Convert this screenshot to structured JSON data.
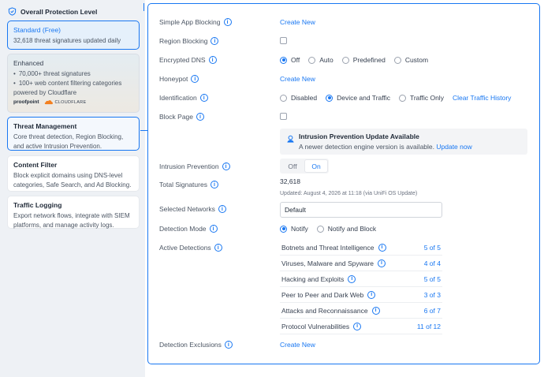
{
  "left": {
    "header": "Overall Protection Level",
    "standard": {
      "title": "Standard (Free)",
      "desc": "32,618 threat signatures updated daily"
    },
    "enhanced": {
      "title": "Enhanced",
      "bullets": [
        "70,000+ threat signatures",
        "100+ web content filtering categories"
      ],
      "powered": "powered by Cloudflare",
      "logo1": "proofpoint",
      "logo2": "CLOUDFLARE"
    },
    "threat": {
      "title": "Threat Management",
      "desc1": "Core threat detection, Region Blocking,",
      "desc2": "and active Intrusion Prevention."
    },
    "content": {
      "title": "Content Filter",
      "desc1": "Block explicit domains using DNS-level",
      "desc2": "categories, Safe Search, and Ad Blocking."
    },
    "logging": {
      "title": "Traffic Logging",
      "desc1": "Export network flows, integrate with SIEM",
      "desc2": "platforms, and manage activity logs."
    }
  },
  "panel": {
    "simple_app": {
      "label": "Simple App Blocking",
      "action": "Create New"
    },
    "region": {
      "label": "Region Blocking"
    },
    "dns": {
      "label": "Encrypted DNS",
      "options": [
        "Off",
        "Auto",
        "Predefined",
        "Custom"
      ],
      "selected": "Off"
    },
    "honeypot": {
      "label": "Honeypot",
      "action": "Create New"
    },
    "identification": {
      "label": "Identification",
      "options": [
        "Disabled",
        "Device and Traffic",
        "Traffic Only"
      ],
      "selected": "Device and Traffic",
      "clear": "Clear Traffic History"
    },
    "blockpage": {
      "label": "Block Page"
    },
    "notice": {
      "title": "Intrusion Prevention Update Available",
      "text": "A newer detection engine version is available.",
      "link": "Update now"
    },
    "ips": {
      "label": "Intrusion Prevention",
      "off": "Off",
      "on": "On",
      "selected": "On"
    },
    "signatures": {
      "label": "Total Signatures",
      "value": "32,618",
      "updated": "Updated: August 4, 2026 at 11:18 (via UniFi OS Update)"
    },
    "networks": {
      "label": "Selected Networks",
      "value": "Default"
    },
    "mode": {
      "label": "Detection Mode",
      "options": [
        "Notify",
        "Notify and Block"
      ],
      "selected": "Notify"
    },
    "active": {
      "label": "Active Detections",
      "rows": [
        {
          "name": "Botnets and Threat Intelligence",
          "count": "5 of 5"
        },
        {
          "name": "Viruses, Malware and Spyware",
          "count": "4 of 4"
        },
        {
          "name": "Hacking and Exploits",
          "count": "5 of 5"
        },
        {
          "name": "Peer to Peer and Dark Web",
          "count": "3 of 3"
        },
        {
          "name": "Attacks and Reconnaissance",
          "count": "6 of 7"
        },
        {
          "name": "Protocol Vulnerabilities",
          "count": "11 of 12"
        }
      ]
    },
    "exclusions": {
      "label": "Detection Exclusions",
      "action": "Create New"
    }
  },
  "colors": {
    "accent": "#1877f2",
    "text": "#2d3748",
    "muted": "#6b7280"
  }
}
